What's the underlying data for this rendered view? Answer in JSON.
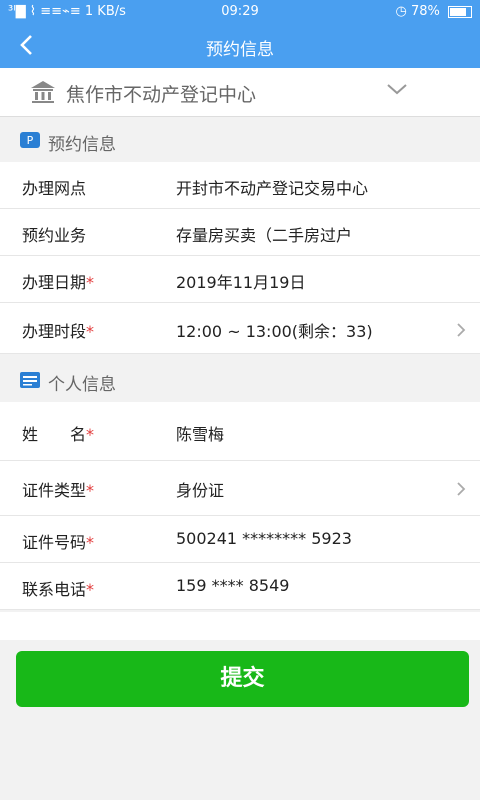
{
  "status_bar": {
    "signal": "³ᴵ▇ ⌇ ≡≡⌁≡",
    "speed": "1 KB/s",
    "time": "09:29",
    "battery": "78%"
  },
  "header": {
    "title": "预约信息"
  },
  "center": {
    "name": "焦作市不动产登记中心"
  },
  "appointment": {
    "section_title": "预约信息",
    "rows": [
      {
        "label": "办理网点",
        "required": "",
        "value": "开封市不动产登记交易中心"
      },
      {
        "label": "预约业务",
        "required": "",
        "value": "存量房买卖（二手房过户"
      },
      {
        "label": "办理日期",
        "required": "*",
        "value": "2019年11月19日"
      },
      {
        "label": "办理时段",
        "required": "*",
        "value": "12:00 ~ 13:00(剩余：33)"
      }
    ]
  },
  "personal": {
    "section_title": "个人信息",
    "rows": [
      {
        "label": "姓　　名",
        "required": "*",
        "value": "陈雪梅"
      },
      {
        "label": "证件类型",
        "required": "*",
        "value": "身份证"
      },
      {
        "label": "证件号码",
        "required": "*",
        "value": "500241 ******** 5923"
      },
      {
        "label": "联系电话",
        "required": "*",
        "value": "159 **** 8549"
      }
    ]
  },
  "submit_label": "提交",
  "colors": {
    "header": "#4a9ff0",
    "submit": "#18b818",
    "required": "#e23b3b"
  }
}
